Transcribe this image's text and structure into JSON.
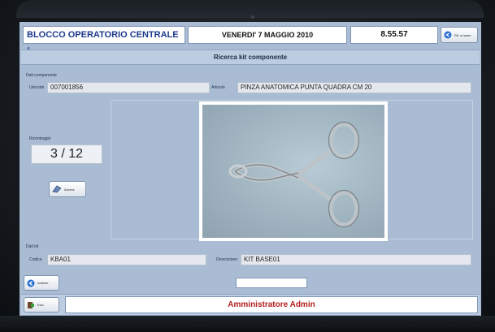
{
  "header": {
    "department": "BLOCCO OPERATORIO CENTRALE /...",
    "date": "VENERDI' 7 MAGGIO 2010",
    "time": "8.55.57",
    "back_home_label": "Rit. a home"
  },
  "page": {
    "title": "Ricerca kit componente"
  },
  "component": {
    "section_label": "Dati componente",
    "unicode_label": "Unicode",
    "unicode_value": "007001856",
    "articolo_label": "Articolo",
    "articolo_value": "PINZA ANATOMICA PUNTA QUADRA CM 20"
  },
  "recount": {
    "label": "Riconteggio",
    "value": "3 / 12",
    "clear_label": "Azzera"
  },
  "kit": {
    "section_label": "Dati kit",
    "codice_label": "Codice",
    "codice_value": "KBA01",
    "descrizione_label": "Descrizione",
    "descrizione_value": "KIT BASE01"
  },
  "footer": {
    "back_label": "Indietro",
    "search_value": "",
    "exit_label": "Esci",
    "user": "Amministratore Admin"
  },
  "colors": {
    "brand_blue": "#1d3a8c",
    "user_red": "#b21e1e",
    "screen_bg": "#a9bcd3"
  }
}
